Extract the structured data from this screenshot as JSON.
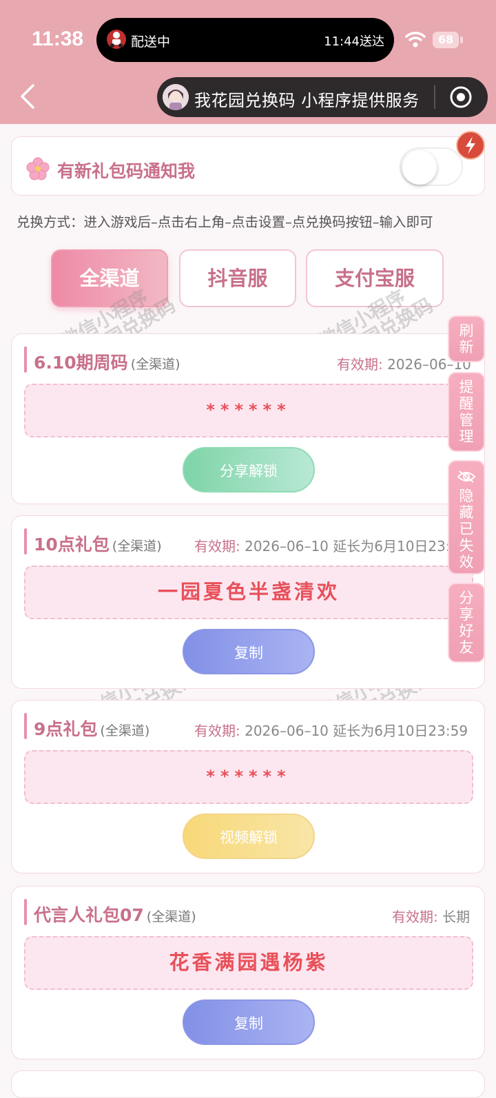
{
  "status_bar": {
    "time": "11:38",
    "island_status": "配送中",
    "island_eta": "11:44送达",
    "battery": "68"
  },
  "nav": {
    "title": "我花园兑换码 小程序提供服务"
  },
  "notify": {
    "label": "有新礼包码通知我",
    "enabled": false
  },
  "method_text": "兑换方式：进入游戏后–点击右上角–点击设置–点兑换码按钮–输入即可",
  "tabs": [
    {
      "label": "全渠道",
      "active": true
    },
    {
      "label": "抖音服",
      "active": false
    },
    {
      "label": "支付宝服",
      "active": false
    }
  ],
  "watermark": {
    "line1": "微信小程序",
    "line2": "我花园兑换码"
  },
  "cards": [
    {
      "name": "6.10期周码",
      "channel": "(全渠道)",
      "valid_key": "有效期:",
      "valid_value": "2026–06–10",
      "code": "******",
      "button": "分享解锁",
      "button_color": "#7fd4a8"
    },
    {
      "name": "10点礼包",
      "channel": "(全渠道)",
      "valid_key": "有效期:",
      "valid_value": "2026–06–10 延长为6月10日23:59",
      "code": "一园夏色半盏清欢",
      "button": "复制",
      "button_color": "#8290e6"
    },
    {
      "name": "9点礼包",
      "channel": "(全渠道)",
      "valid_key": "有效期:",
      "valid_value": "2026–06–10 延长为6月10日23:59",
      "code": "******",
      "button": "视频解锁",
      "button_color": "#f8d878"
    },
    {
      "name": "代言人礼包07",
      "channel": "(全渠道)",
      "valid_key": "有效期:",
      "valid_value": "长期",
      "code": "花香满园遇杨紫",
      "button": "复制",
      "button_color": "#8290e6"
    }
  ],
  "side_buttons": [
    {
      "label": [
        "刷",
        "新"
      ],
      "icon": ""
    },
    {
      "label": [
        "提",
        "醒",
        "管",
        "理"
      ],
      "icon": ""
    },
    {
      "label": [
        "隐",
        "藏",
        "已",
        "失",
        "效"
      ],
      "icon": "eye-slash-icon"
    },
    {
      "label": [
        "分",
        "享",
        "好",
        "友"
      ],
      "icon": ""
    }
  ],
  "colors": {
    "header_bg": "#e8a8b0",
    "accent_pink": "#c8708a",
    "code_red": "#e8505a",
    "tab_active": "#ee8aa6"
  }
}
